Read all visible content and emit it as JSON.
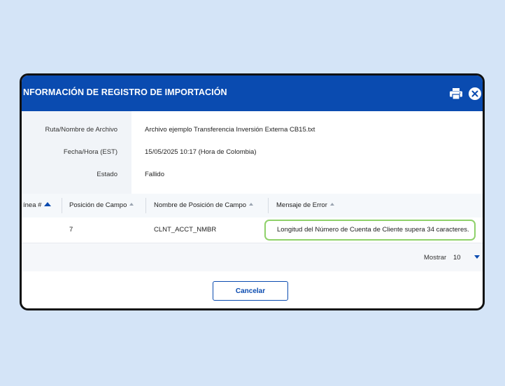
{
  "dialog": {
    "title": "NFORMACIÓN DE REGISTRO DE IMPORTACIÓN",
    "print_icon": "printer-icon",
    "close_icon": "close-circle-icon"
  },
  "info": {
    "path_label": "Ruta/Nombre de Archivo",
    "path_value": "Archivo ejemplo Transferencia Inversión Externa CB15.txt",
    "date_label": "Fecha/Hora (EST)",
    "date_value": "15/05/2025 10:17 (Hora de Colombia)",
    "status_label": "Estado",
    "status_value": "Fallido"
  },
  "table": {
    "headers": [
      "ínea #",
      "Posición de Campo",
      "Nombre de Posición de Campo",
      "Mensaje de Error"
    ],
    "rows": [
      {
        "line": "",
        "position": "7",
        "position_name": "CLNT_ACCT_NMBR",
        "error": "Longitud del Número de Cuenta de Cliente supera 34 caracteres."
      }
    ],
    "highlight_color": "#8fd16a"
  },
  "pagination": {
    "show_label": "Mostrar",
    "page_size": "10"
  },
  "buttons": {
    "cancel_label": "Cancelar"
  },
  "colors": {
    "brand": "#0a4bb0",
    "background": "#d4e4f7"
  }
}
